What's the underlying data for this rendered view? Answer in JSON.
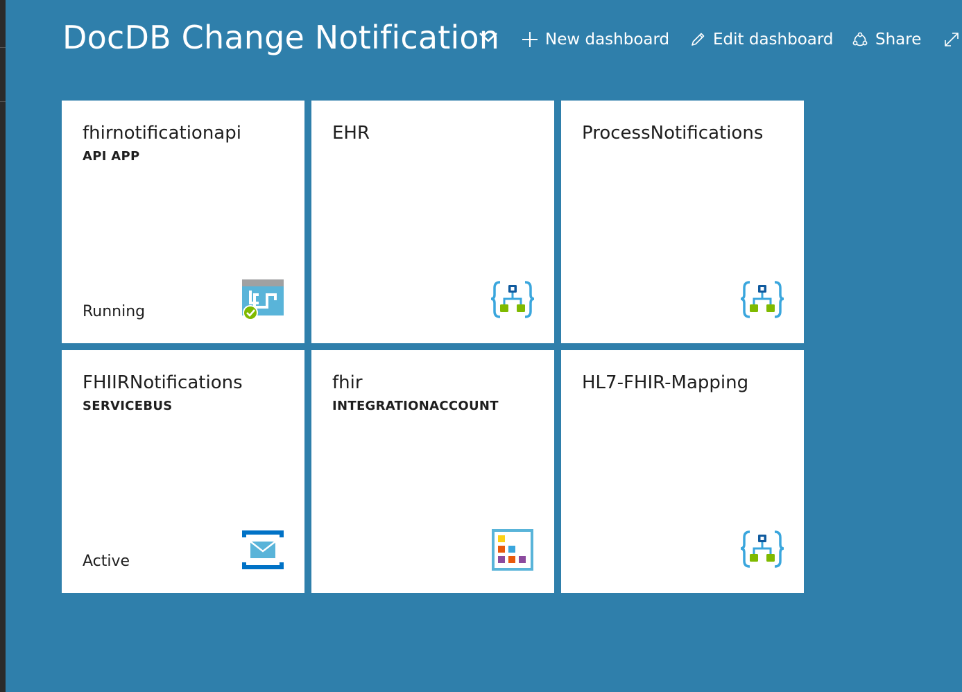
{
  "dashboard": {
    "title": "DocDB Change Notification"
  },
  "commands": {
    "new_dashboard": "New dashboard",
    "edit_dashboard": "Edit dashboard",
    "share": "Share"
  },
  "tiles": [
    {
      "title": "fhirnotificationapi",
      "subtitle": "API APP",
      "status": "Running",
      "icon": "api-app-icon"
    },
    {
      "title": "EHR",
      "subtitle": "",
      "status": "",
      "icon": "logic-app-icon"
    },
    {
      "title": "ProcessNotifications",
      "subtitle": "",
      "status": "",
      "icon": "logic-app-icon"
    },
    {
      "title": "FHIIRNotifications",
      "subtitle": "SERVICEBUS",
      "status": "Active",
      "icon": "service-bus-icon"
    },
    {
      "title": "fhir",
      "subtitle": "INTEGRATIONACCOUNT",
      "status": "",
      "icon": "integration-account-icon"
    },
    {
      "title": "HL7-FHIR-Mapping",
      "subtitle": "",
      "status": "",
      "icon": "logic-app-icon"
    }
  ],
  "colors": {
    "background": "#2f7fab",
    "tile": "#ffffff",
    "logic_app_blue": "#3aa6dd",
    "logic_app_green": "#7fba00",
    "logic_app_navy": "#0f5a9e",
    "service_bus_blue": "#0072c6",
    "running_green": "#7fba00"
  }
}
